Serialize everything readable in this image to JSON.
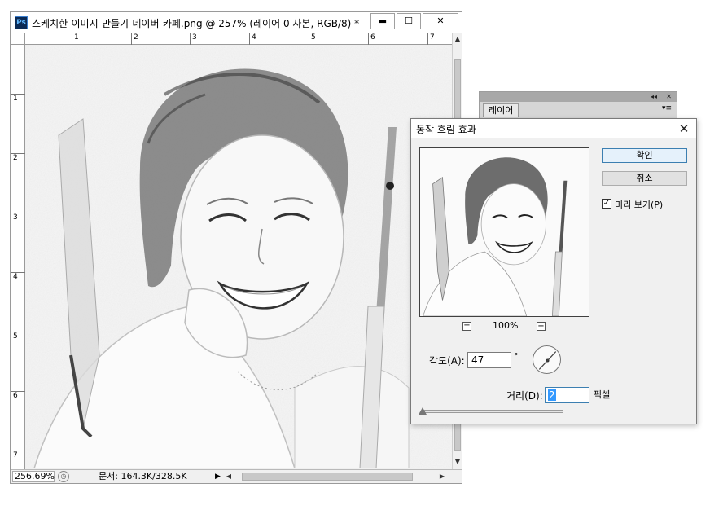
{
  "document": {
    "app_icon": "Ps",
    "title": "스케치한-이미지-만들기-네이버-카페.png @ 257% (레이어 0 사본, RGB/8) *",
    "window_buttons": {
      "minimize": "▬",
      "maximize": "☐",
      "close": "✕"
    },
    "ruler_top": [
      "1",
      "2",
      "3",
      "4",
      "5",
      "6",
      "7"
    ],
    "ruler_left": [
      "1",
      "2",
      "3",
      "4",
      "5",
      "6",
      "7"
    ],
    "status": {
      "zoom": "256.69%",
      "doc_info": "문서: 164.3K/328.5K",
      "menu_arrow": "▶"
    },
    "scroll_arrows": {
      "up": "▲",
      "down": "▼",
      "left": "◀",
      "right": "▶"
    },
    "image_alt": "sketch of smiling woman holding a flute"
  },
  "layers_panel": {
    "tab": "레이어",
    "collapse": "◂◂",
    "close": "✕",
    "menu": "▾≡"
  },
  "dialog": {
    "title": "동작 흐림 효과",
    "close": "✕",
    "ok_label": "확인",
    "cancel_label": "취소",
    "preview_label": "미리 보기(P)",
    "preview_checked": true,
    "zoom_minus": "−",
    "zoom_plus": "+",
    "zoom_level": "100%",
    "angle_label": "각도(A):",
    "angle_value": "47",
    "degree_sign": "°",
    "distance_label": "거리(D):",
    "distance_value": "2",
    "unit_label": "픽셀",
    "slider_fraction": 0.0
  },
  "colors": {
    "accent": "#3c7fb1",
    "ps_icon_bg": "#0b2a55",
    "ps_icon_fg": "#5fb7ff"
  }
}
